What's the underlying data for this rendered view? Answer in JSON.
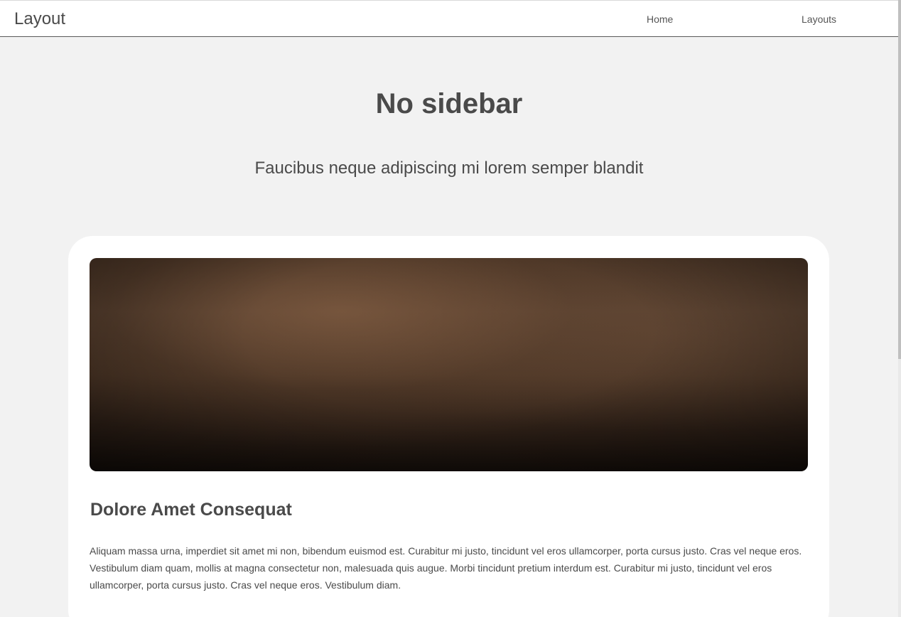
{
  "header": {
    "logo": "Layout",
    "nav": [
      {
        "label": "Home"
      },
      {
        "label": "Layouts"
      }
    ]
  },
  "hero": {
    "title": "No sidebar",
    "subtitle": "Faucibus neque adipiscing mi lorem semper blandit"
  },
  "article": {
    "title": "Dolore Amet Consequat",
    "body": "Aliquam massa urna, imperdiet sit amet mi non, bibendum euismod est. Curabitur mi justo, tincidunt vel eros ullamcorper, porta cursus justo. Cras vel neque eros. Vestibulum diam quam, mollis at magna consectetur non, malesuada quis augue. Morbi tincidunt pretium interdum est. Curabitur mi justo, tincidunt vel eros ullamcorper, porta cursus justo. Cras vel neque eros. Vestibulum diam."
  },
  "colors": {
    "background": "#f2f2f2",
    "text": "#4a4a4a",
    "card": "#ffffff"
  }
}
